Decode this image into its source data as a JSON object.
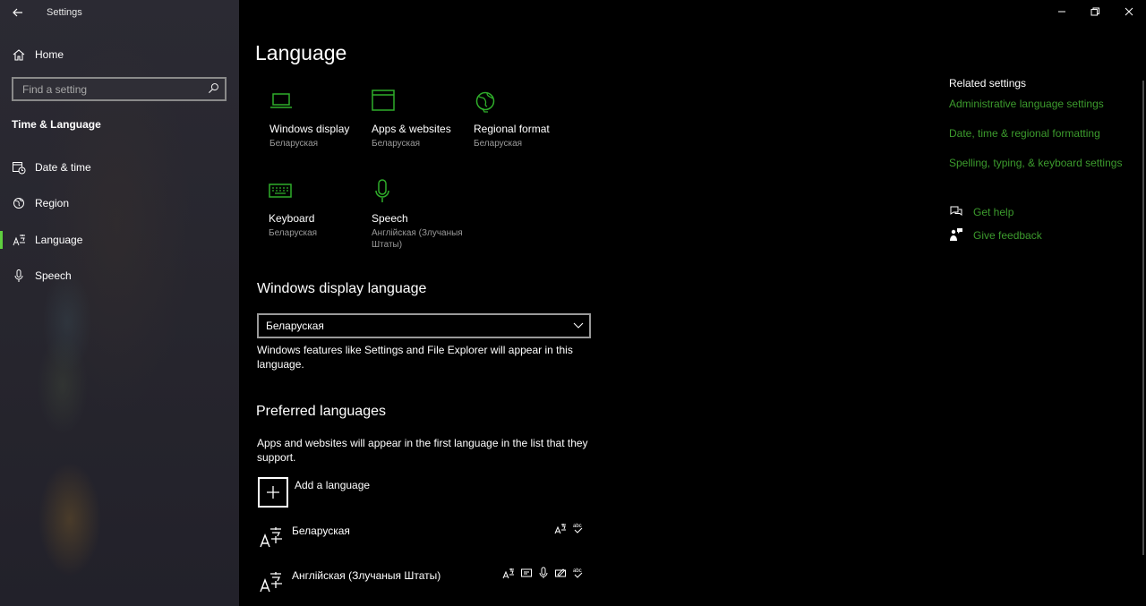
{
  "window": {
    "title": "Settings"
  },
  "sidebar": {
    "home_label": "Home",
    "search_placeholder": "Find a setting",
    "section_title": "Time & Language",
    "items": [
      {
        "label": "Date & time",
        "icon": "calendar-clock-icon"
      },
      {
        "label": "Region",
        "icon": "globe-icon"
      },
      {
        "label": "Language",
        "icon": "language-icon",
        "active": true
      },
      {
        "label": "Speech",
        "icon": "microphone-icon"
      }
    ]
  },
  "main": {
    "title": "Language",
    "tiles": [
      {
        "label": "Windows display",
        "sub": "Беларуская",
        "icon": "laptop-icon"
      },
      {
        "label": "Apps & websites",
        "sub": "Беларуская",
        "icon": "window-icon"
      },
      {
        "label": "Regional format",
        "sub": "Беларуская",
        "icon": "globe-icon"
      },
      {
        "label": "Keyboard",
        "sub": "Беларуская",
        "icon": "keyboard-icon"
      },
      {
        "label": "Speech",
        "sub": "Англійская (Злучаныя Штаты)",
        "icon": "microphone-icon"
      }
    ],
    "display_language": {
      "heading": "Windows display language",
      "selected": "Беларуская",
      "description": "Windows features like Settings and File Explorer will appear in this language."
    },
    "preferred": {
      "heading": "Preferred languages",
      "description": "Apps and websites will appear in the first language in the list that they support.",
      "add_label": "Add a language",
      "languages": [
        {
          "name": "Беларуская",
          "features": [
            "display-language-icon",
            "spelling-icon"
          ]
        },
        {
          "name": "Англійская (Злучаныя Штаты)",
          "features": [
            "display-language-icon",
            "text-to-speech-icon",
            "microphone-icon",
            "handwriting-icon",
            "spelling-icon"
          ]
        }
      ]
    }
  },
  "related": {
    "title": "Related settings",
    "links": [
      "Administrative language settings",
      "Date, time & regional formatting",
      "Spelling, typing, & keyboard settings"
    ],
    "help": [
      {
        "label": "Get help",
        "icon": "chat-help-icon"
      },
      {
        "label": "Give feedback",
        "icon": "feedback-icon"
      }
    ]
  },
  "colors": {
    "accent": "#3c9b2d",
    "icon_accent": "#2fae2a",
    "background": "#000000",
    "sidebar": "#2a2930"
  }
}
